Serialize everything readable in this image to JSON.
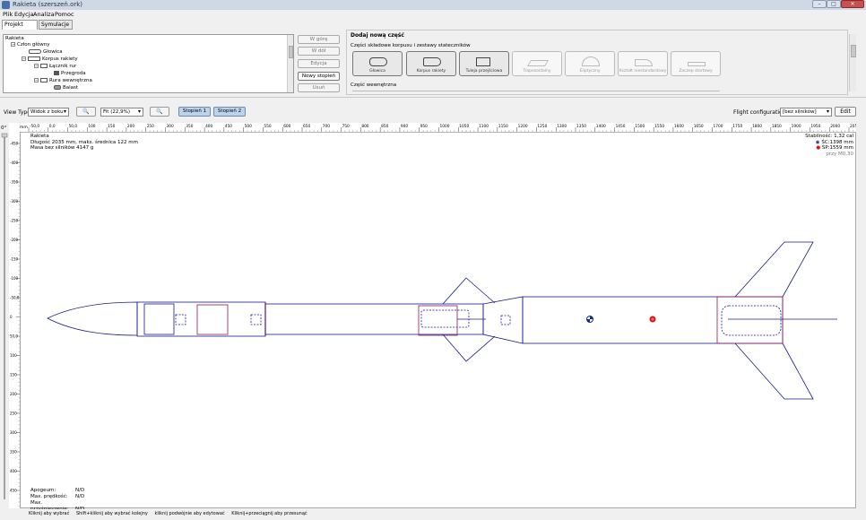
{
  "window": {
    "title": "Rakieta (szerszeń.ork)"
  },
  "menu": [
    "Plik",
    "Edycja",
    "Analiza",
    "Pomoc"
  ],
  "tabs": [
    "Projekt rakiety",
    "Symulacje lotu"
  ],
  "tree": {
    "items": [
      {
        "label": "Rakieta"
      },
      {
        "label": "Człon główny"
      },
      {
        "label": "Głowica"
      },
      {
        "label": "Korpus rakiety"
      },
      {
        "label": "Łącznik rur"
      },
      {
        "label": "Przegroda"
      },
      {
        "label": "Rura wewnętrzna"
      },
      {
        "label": "Balast"
      }
    ]
  },
  "side_buttons": [
    "W górę",
    "W dół",
    "Edycja",
    "Nowy stopień",
    "Usuń"
  ],
  "add_part": {
    "title": "Dodaj nową część",
    "section_body": "Części składowe korpusu i zestawy stateczników",
    "section_inner": "Część wewnętrzna",
    "parts": [
      "Głowica",
      "Korpus rakiety",
      "Tuleja przejściowa",
      "Trapezoidalny",
      "Eliptyczny",
      "Kształt niestandardowy",
      "Zaczep startowy"
    ]
  },
  "viewbar": {
    "view_type_label": "View Type:",
    "view_type_value": "Widok z boku",
    "zoom_value": "Fit (22,9%)",
    "stage1": "Stopień 1",
    "stage2": "Stopień 2",
    "flight_config_label": "Flight configuration:",
    "flight_config_value": "[bez silników]",
    "edit_label": "Edit"
  },
  "ruler": {
    "unit": "mm",
    "x_ticks": [
      "-50,0",
      "0,0",
      "50,0",
      "100",
      "150",
      "200",
      "250",
      "300",
      "350",
      "400",
      "450",
      "500",
      "550",
      "600",
      "650",
      "700",
      "750",
      "800",
      "850",
      "900",
      "950",
      "1000",
      "1050",
      "1100",
      "1150",
      "1200",
      "1250",
      "1300",
      "1350",
      "1400",
      "1450",
      "1500",
      "1550",
      "1600",
      "1650",
      "1700",
      "1750",
      "1800",
      "1850",
      "1900",
      "1950",
      "2000",
      "2050"
    ],
    "y_ticks": [
      "-450",
      "-400",
      "-350",
      "-300",
      "-250",
      "-200",
      "-150",
      "-100",
      "-50,0",
      "0",
      "50,0",
      "100",
      "150",
      "200",
      "250",
      "300",
      "350",
      "400",
      "450"
    ],
    "zoom_label": "0°"
  },
  "info": {
    "name": "Rakieta",
    "length_line": "Długość 2035 mm, maks. średnica 122 mm",
    "mass_line": "Masa bez silników 4147 g",
    "stability": "Stabilność: 1,32 cal",
    "cg": "ŚC:1398 mm",
    "cp": "ŚP:1559 mm",
    "mach": "przy M0,30",
    "apogee_label": "Apogeum:",
    "apogee_value": "N/D",
    "vmax_label": "Max. prędkość:",
    "vmax_value": "N/D",
    "amax_label": "Max. przyśpieszenie:",
    "amax_value": "N/D"
  },
  "status": [
    "Kliknij aby wybrać",
    "Shift+kliknij aby wybrać kolejny",
    "kliknij podwójnie aby edytować",
    "Kliknij+przeciągnij aby przesunąć"
  ],
  "colors": {
    "outline": "#1a1a8c",
    "selected": "#8a1a5a",
    "cg": "#1a2a8c",
    "cp": "#e01010"
  }
}
